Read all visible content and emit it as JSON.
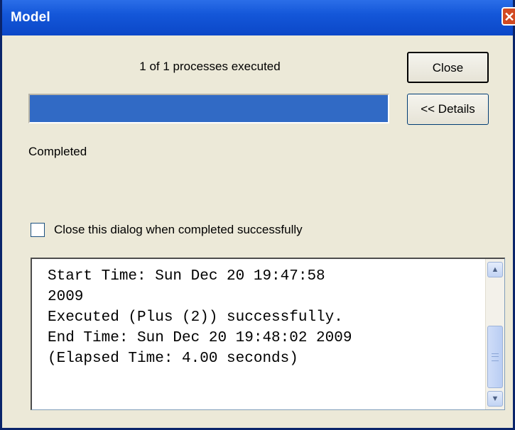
{
  "window": {
    "title": "Model",
    "close_icon": "close-icon"
  },
  "progress": {
    "status_text": "1 of 1 processes executed",
    "fraction": 1.0,
    "fill_color": "#316ac5"
  },
  "buttons": {
    "close_label": "Close",
    "details_label": "<< Details"
  },
  "status": {
    "completed_label": "Completed"
  },
  "option": {
    "checkbox_label": "Close this dialog when completed successfully",
    "checked": false
  },
  "log": {
    "text": "Start Time: Sun Dec 20 19:47:58\n2009\nExecuted (Plus (2)) successfully.\nEnd Time: Sun Dec 20 19:48:02 2009\n(Elapsed Time: 4.00 seconds)"
  },
  "scrollbar": {
    "up_icon": "scroll-up-arrow-icon",
    "down_icon": "scroll-down-arrow-icon",
    "up_glyph": "▲",
    "down_glyph": "▼"
  }
}
